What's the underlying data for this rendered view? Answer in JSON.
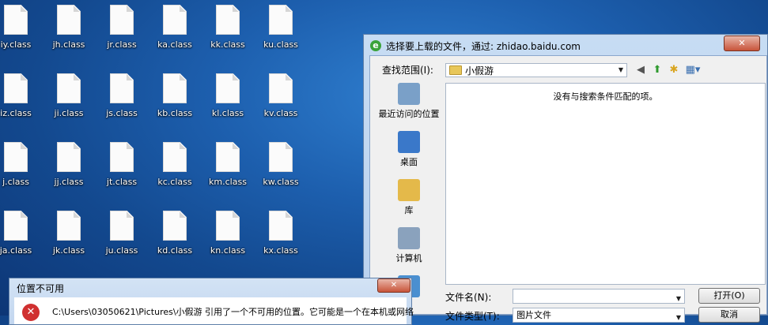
{
  "desktop": {
    "files": [
      [
        "iy.class",
        "jh.class",
        "jr.class",
        "ka.class",
        "kk.class",
        "ku.class"
      ],
      [
        "iz.class",
        "ji.class",
        "js.class",
        "kb.class",
        "kl.class",
        "kv.class"
      ],
      [
        "j.class",
        "jj.class",
        "jt.class",
        "kc.class",
        "km.class",
        "kw.class"
      ],
      [
        "ja.class",
        "jk.class",
        "ju.class",
        "kd.class",
        "kn.class",
        "kx.class"
      ]
    ]
  },
  "dialog": {
    "title": "选择要上载的文件，通过: zhidao.baidu.com",
    "close": "✕",
    "look_in_label": "查找范围(I):",
    "look_in_value": "小假游",
    "places": [
      {
        "label": "最近访问的位置",
        "icon": "recent-places-icon",
        "color": "#7aa0c8"
      },
      {
        "label": "桌面",
        "icon": "desktop-icon",
        "color": "#3a78c9"
      },
      {
        "label": "库",
        "icon": "libraries-icon",
        "color": "#e4b94a"
      },
      {
        "label": "计算机",
        "icon": "computer-icon",
        "color": "#8aa2bd"
      },
      {
        "label": "",
        "icon": "network-icon",
        "color": "#4a8fd0"
      }
    ],
    "empty_message": "没有与搜索条件匹配的项。",
    "filename_label": "文件名(N):",
    "filename_value": "",
    "filetype_label": "文件类型(T):",
    "filetype_value": "图片文件",
    "open_button": "打开(O)",
    "cancel_button": "取消"
  },
  "error": {
    "title": "位置不可用",
    "close": "✕",
    "icon": "✕",
    "message": "C:\\Users\\03050621\\Pictures\\小假游 引用了一个不可用的位置。它可能是一个在本机或网络"
  }
}
